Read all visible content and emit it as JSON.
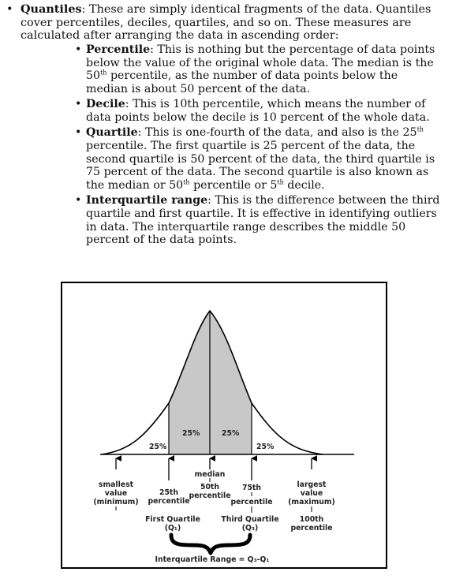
{
  "quantiles": {
    "term": "Quantiles",
    "text": ": These are simply identical fragments of the data. Quantiles cover percentiles, deciles, quartiles, and so on. These measures are calculated after arranging the data in ascending order:"
  },
  "items": [
    {
      "term": "Percentile",
      "text_a": ": This is nothing but the percentage of data points below the value of the original whole data. The median is the 50",
      "sup_a": "th",
      "text_b": " percentile, as the number of data points below the median is about 50 percent of the data."
    },
    {
      "term": "Decile",
      "text_a": ": This is 10th percentile, which means the number of data points below the decile is 10 percent of the whole data."
    },
    {
      "term": "Quartile",
      "text_a": ": This is one-fourth of the data, and also is the 25",
      "sup_a": "th",
      "text_b": " percentile. The first quartile is 25 percent of the data, the second quartile is 50 percent of the data, the third quartile is 75 percent of the data. The second quartile is also known as the median or 50",
      "sup_b": "th",
      "text_c": " percentile or 5",
      "sup_c": "th",
      "text_d": " decile."
    },
    {
      "term": "Interquartile range",
      "text_a": ": This is the difference between the third quartile and first quartile. It is effective in identifying outliers in data. The interquartile range describes the middle 50 percent of the data points."
    }
  ],
  "figure": {
    "pct_left_tail": "25%",
    "pct_left_mid": "25%",
    "pct_right_mid": "25%",
    "pct_right_tail": "25%",
    "smallest": [
      "smallest",
      "value",
      "(minimum)"
    ],
    "p25": [
      "25th",
      "percentile"
    ],
    "median": [
      "median",
      "50th",
      "percentile"
    ],
    "p75": [
      "75th",
      "percentile"
    ],
    "largest": [
      "largest",
      "value",
      "(maximum)"
    ],
    "q1": [
      "First Quartile",
      "(Q₁)"
    ],
    "q3": [
      "Third Quartile",
      "(Q₃)"
    ],
    "p100": [
      "100th",
      "percentile"
    ],
    "iqr": "Interquartile Range = Q₃-Q₁"
  }
}
